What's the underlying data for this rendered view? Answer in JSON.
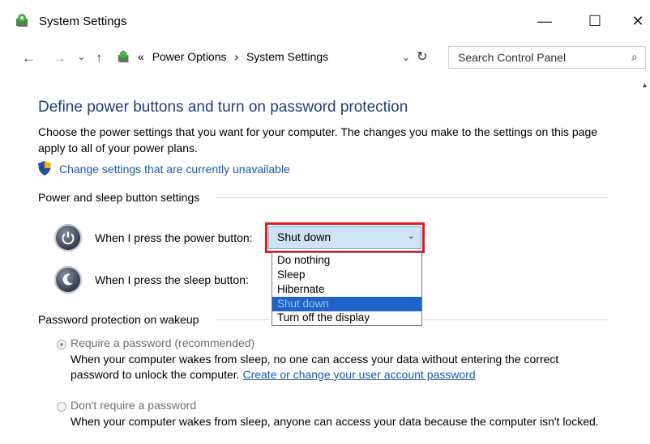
{
  "window": {
    "title": "System Settings",
    "minimize_glyph": "—",
    "maximize_glyph": "☐",
    "close_glyph": "✕"
  },
  "nav": {
    "back_glyph": "←",
    "forward_glyph": "→",
    "recent_glyph": "⌄",
    "up_glyph": "↑",
    "breadcrumb_prefix": "«",
    "breadcrumb": [
      "Power Options",
      "System Settings"
    ],
    "breadcrumb_sep": "›",
    "dropdown_glyph": "⌄",
    "refresh_glyph": "↻",
    "search_placeholder": "Search Control Panel",
    "search_glyph": "⌕"
  },
  "main": {
    "heading": "Define power buttons and turn on password protection",
    "description": "Choose the power settings that you want for your computer. The changes you make to the settings on this page apply to all of your power plans.",
    "change_link": "Change settings that are currently unavailable"
  },
  "power_section": {
    "title": "Power and sleep button settings",
    "power_button_label": "When I press the power button:",
    "sleep_button_label": "When I press the sleep button:",
    "power_button_value": "Shut down",
    "select_chevron": "⌄",
    "options": [
      "Do nothing",
      "Sleep",
      "Hibernate",
      "Shut down",
      "Turn off the display"
    ],
    "selected_option": "Shut down"
  },
  "password_section": {
    "title": "Password protection on wakeup",
    "require_label": "Require a password (recommended)",
    "require_text": "When your computer wakes from sleep, no one can access your data without entering the correct password to unlock the computer.",
    "require_link": "Create or change your user account password",
    "norequire_label": "Don't require a password",
    "norequire_text": "When your computer wakes from sleep, anyone can access your data because the computer isn't locked."
  },
  "colors": {
    "heading": "#1e3f7a",
    "link": "#1a5aa8",
    "highlight_border": "#e31b23",
    "dropdown_selected": "#1e64c8",
    "select_bg": "#cde3f7"
  }
}
